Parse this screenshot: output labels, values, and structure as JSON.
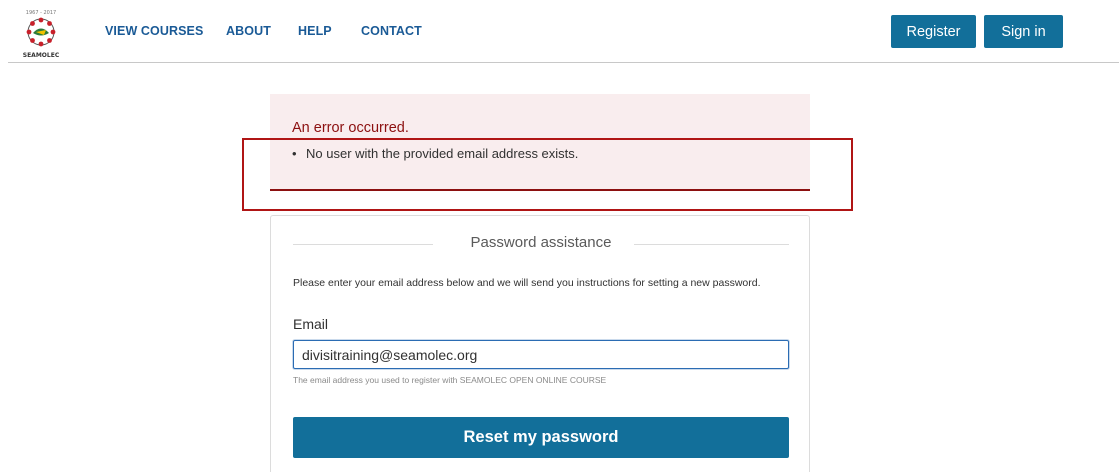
{
  "header": {
    "logo_text": "SEAMOLEC",
    "logo_years": "1967 - 2017",
    "nav": [
      {
        "label": "VIEW COURSES"
      },
      {
        "label": "ABOUT"
      },
      {
        "label": "HELP"
      },
      {
        "label": "CONTACT"
      }
    ],
    "register_label": "Register",
    "signin_label": "Sign in"
  },
  "error": {
    "title": "An error occurred.",
    "items": [
      "No user with the provided email address exists."
    ]
  },
  "form": {
    "legend": "Password assistance",
    "instructions": "Please enter your email address below and we will send you instructions for setting a new password.",
    "email_label": "Email",
    "email_value": "divisitraining@seamolec.org",
    "help_text": "The email address you used to register with SEAMOLEC OPEN ONLINE COURSE",
    "submit_label": "Reset my password"
  },
  "colors": {
    "primary": "#126f9a",
    "nav_link": "#1a5a96",
    "error_text": "#8c1010",
    "error_bg": "#f9edee",
    "annotation": "#b01515"
  }
}
